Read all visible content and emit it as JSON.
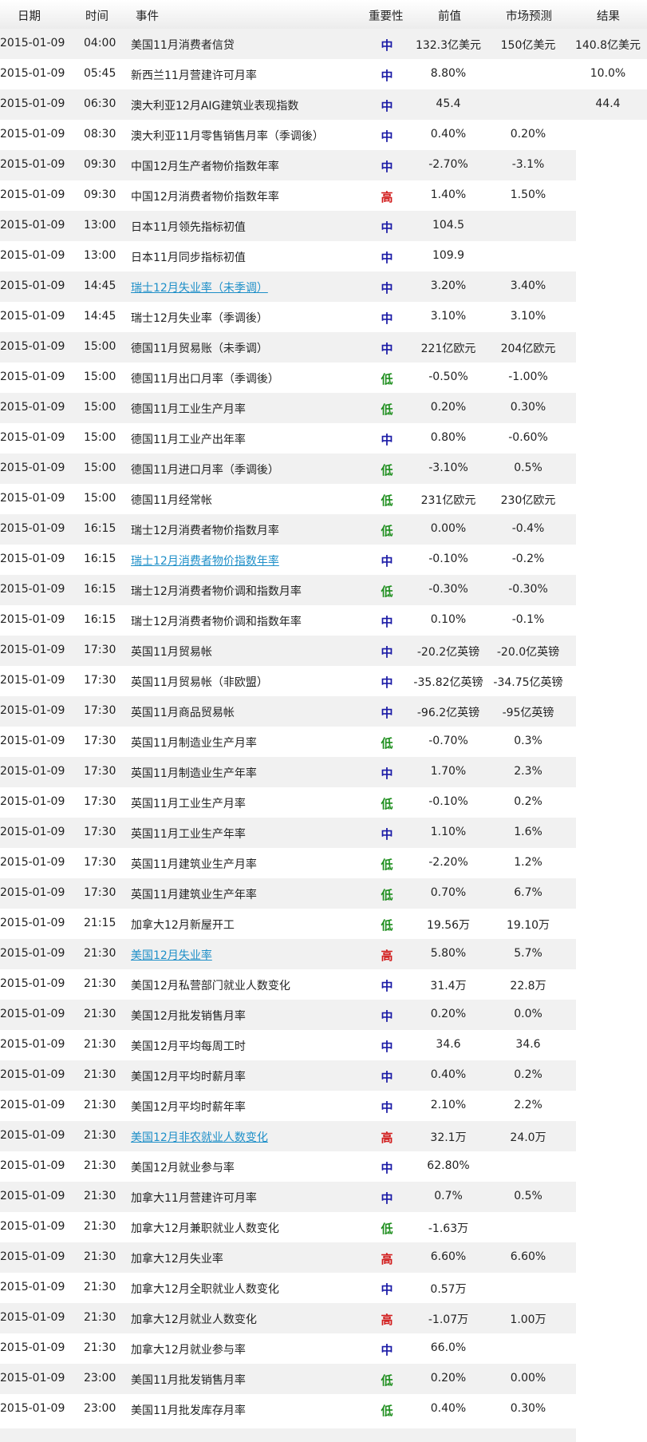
{
  "columns": {
    "date": "日期",
    "time": "时间",
    "event": "事件",
    "importance": "重要性",
    "previous": "前值",
    "forecast": "市场预测",
    "actual": "结果"
  },
  "colors": {
    "mid": "#1a1aa6",
    "high": "#d11a1a",
    "low": "#1f8f1f",
    "link": "#1e8fc8",
    "row_alt": "#f1f1f1"
  },
  "rows": [
    {
      "date": "2015-01-09",
      "time": "04:00",
      "event": "美国11月消费者信贷",
      "imp": "中",
      "prev": "132.3亿美元",
      "fore": "150亿美元",
      "act": "140.8亿美元"
    },
    {
      "date": "2015-01-09",
      "time": "05:45",
      "event": "新西兰11月营建许可月率",
      "imp": "中",
      "prev": "8.80%",
      "fore": "",
      "act": "10.0%"
    },
    {
      "date": "2015-01-09",
      "time": "06:30",
      "event": "澳大利亚12月AIG建筑业表现指数",
      "imp": "中",
      "prev": "45.4",
      "fore": "",
      "act": "44.4"
    },
    {
      "date": "2015-01-09",
      "time": "08:30",
      "event": "澳大利亚11月零售销售月率（季调後）",
      "imp": "中",
      "prev": "0.40%",
      "fore": "0.20%",
      "act": ""
    },
    {
      "date": "2015-01-09",
      "time": "09:30",
      "event": "中国12月生产者物价指数年率",
      "imp": "中",
      "prev": "-2.70%",
      "fore": "-3.1%",
      "act": ""
    },
    {
      "date": "2015-01-09",
      "time": "09:30",
      "event": "中国12月消费者物价指数年率",
      "imp": "高",
      "prev": "1.40%",
      "fore": "1.50%",
      "act": ""
    },
    {
      "date": "2015-01-09",
      "time": "13:00",
      "event": "日本11月领先指标初值",
      "imp": "中",
      "prev": "104.5",
      "fore": "",
      "act": ""
    },
    {
      "date": "2015-01-09",
      "time": "13:00",
      "event": "日本11月同步指标初值",
      "imp": "中",
      "prev": "109.9",
      "fore": "",
      "act": ""
    },
    {
      "date": "2015-01-09",
      "time": "14:45",
      "event": "瑞士12月失业率（未季调）",
      "imp": "中",
      "prev": "3.20%",
      "fore": "3.40%",
      "act": "",
      "link": true
    },
    {
      "date": "2015-01-09",
      "time": "14:45",
      "event": "瑞士12月失业率（季调後）",
      "imp": "中",
      "prev": "3.10%",
      "fore": "3.10%",
      "act": ""
    },
    {
      "date": "2015-01-09",
      "time": "15:00",
      "event": "德国11月贸易账（未季调）",
      "imp": "中",
      "prev": "221亿欧元",
      "fore": "204亿欧元",
      "act": ""
    },
    {
      "date": "2015-01-09",
      "time": "15:00",
      "event": "德国11月出口月率（季调後）",
      "imp": "低",
      "prev": "-0.50%",
      "fore": "-1.00%",
      "act": ""
    },
    {
      "date": "2015-01-09",
      "time": "15:00",
      "event": "德国11月工业生产月率",
      "imp": "低",
      "prev": "0.20%",
      "fore": "0.30%",
      "act": ""
    },
    {
      "date": "2015-01-09",
      "time": "15:00",
      "event": "德国11月工业产出年率",
      "imp": "中",
      "prev": "0.80%",
      "fore": "-0.60%",
      "act": ""
    },
    {
      "date": "2015-01-09",
      "time": "15:00",
      "event": "德国11月进口月率（季调後）",
      "imp": "低",
      "prev": "-3.10%",
      "fore": "0.5%",
      "act": ""
    },
    {
      "date": "2015-01-09",
      "time": "15:00",
      "event": "德国11月经常帐",
      "imp": "低",
      "prev": "231亿欧元",
      "fore": "230亿欧元",
      "act": ""
    },
    {
      "date": "2015-01-09",
      "time": "16:15",
      "event": "瑞士12月消费者物价指数月率",
      "imp": "低",
      "prev": "0.00%",
      "fore": "-0.4%",
      "act": ""
    },
    {
      "date": "2015-01-09",
      "time": "16:15",
      "event": "瑞士12月消费者物价指数年率",
      "imp": "中",
      "prev": "-0.10%",
      "fore": "-0.2%",
      "act": "",
      "link": true
    },
    {
      "date": "2015-01-09",
      "time": "16:15",
      "event": "瑞士12月消费者物价调和指数月率",
      "imp": "低",
      "prev": "-0.30%",
      "fore": "-0.30%",
      "act": ""
    },
    {
      "date": "2015-01-09",
      "time": "16:15",
      "event": "瑞士12月消费者物价调和指数年率",
      "imp": "中",
      "prev": "0.10%",
      "fore": "-0.1%",
      "act": ""
    },
    {
      "date": "2015-01-09",
      "time": "17:30",
      "event": "英国11月贸易帐",
      "imp": "中",
      "prev": "-20.2亿英镑",
      "fore": "-20.0亿英镑",
      "act": ""
    },
    {
      "date": "2015-01-09",
      "time": "17:30",
      "event": "英国11月贸易帐（非欧盟）",
      "imp": "中",
      "prev": "-35.82亿英镑",
      "fore": "-34.75亿英镑",
      "act": ""
    },
    {
      "date": "2015-01-09",
      "time": "17:30",
      "event": "英国11月商品贸易帐",
      "imp": "中",
      "prev": "-96.2亿英镑",
      "fore": "-95亿英镑",
      "act": ""
    },
    {
      "date": "2015-01-09",
      "time": "17:30",
      "event": "英国11月制造业生产月率",
      "imp": "低",
      "prev": "-0.70%",
      "fore": "0.3%",
      "act": ""
    },
    {
      "date": "2015-01-09",
      "time": "17:30",
      "event": "英国11月制造业生产年率",
      "imp": "中",
      "prev": "1.70%",
      "fore": "2.3%",
      "act": ""
    },
    {
      "date": "2015-01-09",
      "time": "17:30",
      "event": "英国11月工业生产月率",
      "imp": "低",
      "prev": "-0.10%",
      "fore": "0.2%",
      "act": ""
    },
    {
      "date": "2015-01-09",
      "time": "17:30",
      "event": "英国11月工业生产年率",
      "imp": "中",
      "prev": "1.10%",
      "fore": "1.6%",
      "act": ""
    },
    {
      "date": "2015-01-09",
      "time": "17:30",
      "event": "英国11月建筑业生产月率",
      "imp": "低",
      "prev": "-2.20%",
      "fore": "1.2%",
      "act": ""
    },
    {
      "date": "2015-01-09",
      "time": "17:30",
      "event": "英国11月建筑业生产年率",
      "imp": "低",
      "prev": "0.70%",
      "fore": "6.7%",
      "act": ""
    },
    {
      "date": "2015-01-09",
      "time": "21:15",
      "event": "加拿大12月新屋开工",
      "imp": "低",
      "prev": "19.56万",
      "fore": "19.10万",
      "act": ""
    },
    {
      "date": "2015-01-09",
      "time": "21:30",
      "event": "美国12月失业率",
      "imp": "高",
      "prev": "5.80%",
      "fore": "5.7%",
      "act": "",
      "link": true
    },
    {
      "date": "2015-01-09",
      "time": "21:30",
      "event": "美国12月私营部门就业人数变化",
      "imp": "中",
      "prev": "31.4万",
      "fore": "22.8万",
      "act": ""
    },
    {
      "date": "2015-01-09",
      "time": "21:30",
      "event": "美国12月批发销售月率",
      "imp": "中",
      "prev": "0.20%",
      "fore": "0.0%",
      "act": ""
    },
    {
      "date": "2015-01-09",
      "time": "21:30",
      "event": "美国12月平均每周工时",
      "imp": "中",
      "prev": "34.6",
      "fore": "34.6",
      "act": ""
    },
    {
      "date": "2015-01-09",
      "time": "21:30",
      "event": "美国12月平均时薪月率",
      "imp": "中",
      "prev": "0.40%",
      "fore": "0.2%",
      "act": ""
    },
    {
      "date": "2015-01-09",
      "time": "21:30",
      "event": "美国12月平均时薪年率",
      "imp": "中",
      "prev": "2.10%",
      "fore": "2.2%",
      "act": ""
    },
    {
      "date": "2015-01-09",
      "time": "21:30",
      "event": "美国12月非农就业人数变化",
      "imp": "高",
      "prev": "32.1万",
      "fore": "24.0万",
      "act": "",
      "link": true
    },
    {
      "date": "2015-01-09",
      "time": "21:30",
      "event": "美国12月就业参与率",
      "imp": "中",
      "prev": "62.80%",
      "fore": "",
      "act": ""
    },
    {
      "date": "2015-01-09",
      "time": "21:30",
      "event": "加拿大11月营建许可月率",
      "imp": "中",
      "prev": "0.7%",
      "fore": "0.5%",
      "act": ""
    },
    {
      "date": "2015-01-09",
      "time": "21:30",
      "event": "加拿大12月兼职就业人数变化",
      "imp": "低",
      "prev": "-1.63万",
      "fore": "",
      "act": ""
    },
    {
      "date": "2015-01-09",
      "time": "21:30",
      "event": "加拿大12月失业率",
      "imp": "高",
      "prev": "6.60%",
      "fore": "6.60%",
      "act": ""
    },
    {
      "date": "2015-01-09",
      "time": "21:30",
      "event": "加拿大12月全职就业人数变化",
      "imp": "中",
      "prev": "0.57万",
      "fore": "",
      "act": ""
    },
    {
      "date": "2015-01-09",
      "time": "21:30",
      "event": "加拿大12月就业人数变化",
      "imp": "高",
      "prev": "-1.07万",
      "fore": "1.00万",
      "act": ""
    },
    {
      "date": "2015-01-09",
      "time": "21:30",
      "event": "加拿大12月就业参与率",
      "imp": "中",
      "prev": "66.0%",
      "fore": "",
      "act": ""
    },
    {
      "date": "2015-01-09",
      "time": "23:00",
      "event": "美国11月批发销售月率",
      "imp": "低",
      "prev": "0.20%",
      "fore": "0.00%",
      "act": ""
    },
    {
      "date": "2015-01-09",
      "time": "23:00",
      "event": "美国11月批发库存月率",
      "imp": "低",
      "prev": "0.40%",
      "fore": "0.30%",
      "act": ""
    }
  ]
}
